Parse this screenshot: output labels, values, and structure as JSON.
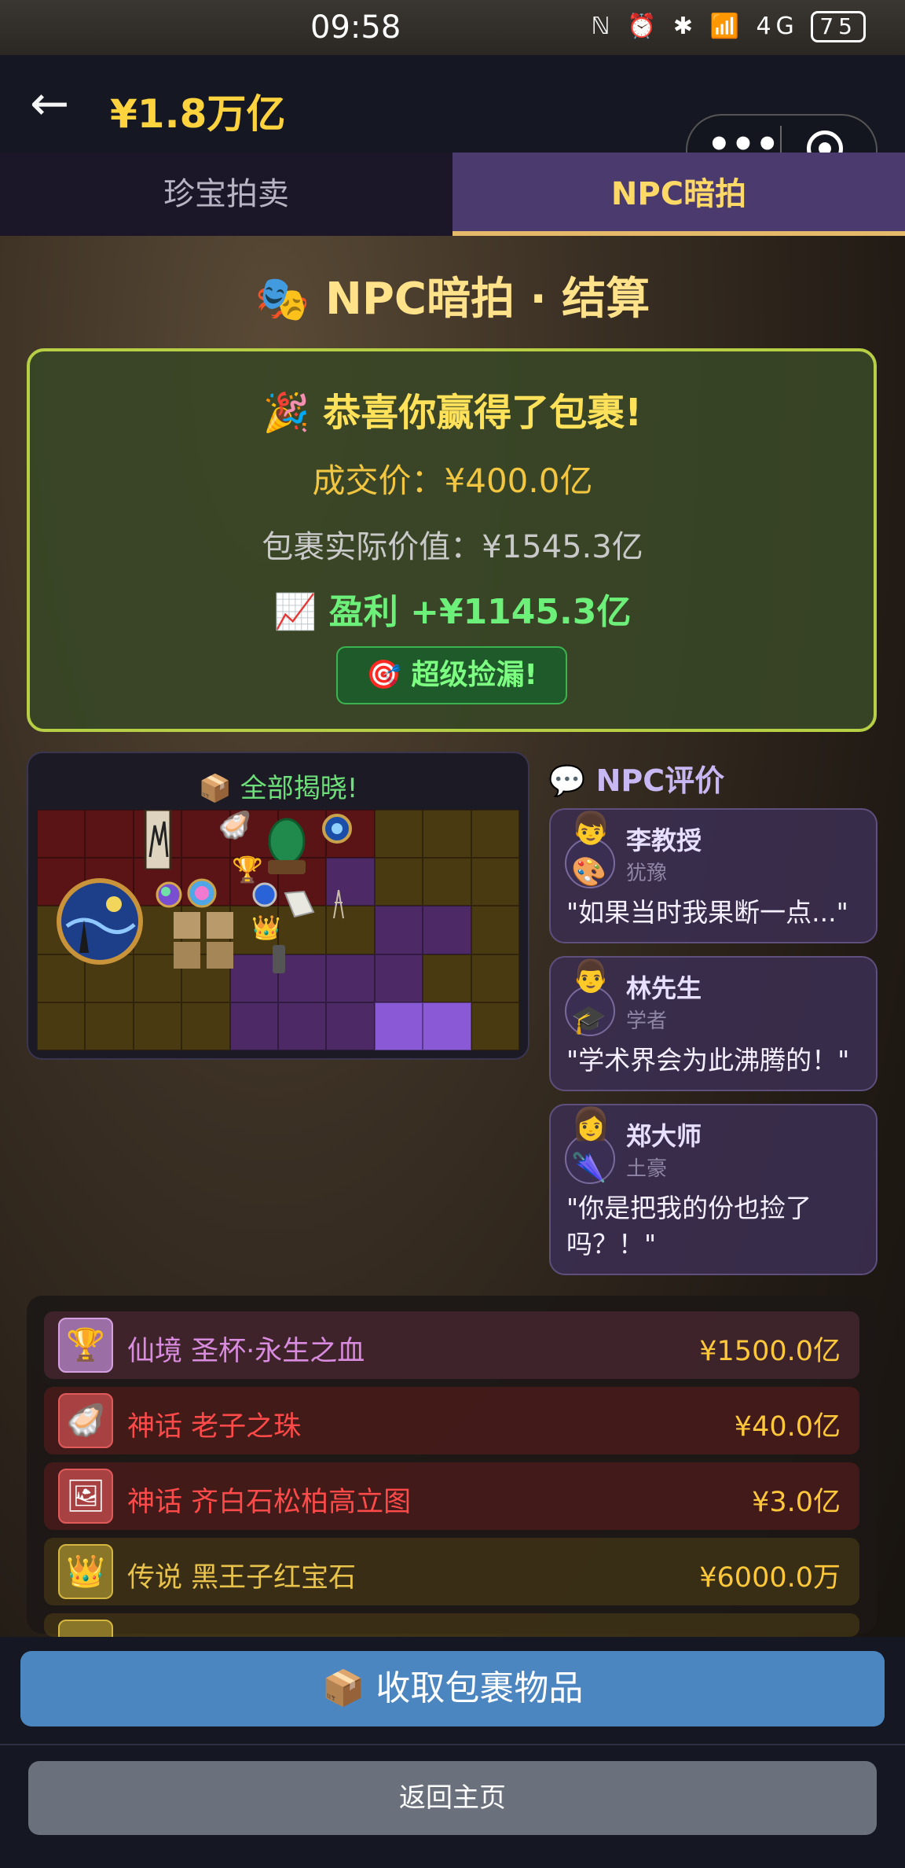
{
  "status_bar": {
    "time": "09:58",
    "icons": "ℕ ⏰ ✱ 📶 4G",
    "battery": "75"
  },
  "header": {
    "back_icon": "←",
    "balance": "¥1.8万亿"
  },
  "capsule": {
    "more": "•••"
  },
  "tabs": [
    {
      "label": "珍宝拍卖",
      "active": false
    },
    {
      "label": "NPC暗拍",
      "active": true
    }
  ],
  "page_title": {
    "icon": "🎭",
    "text": "NPC暗拍 · 结算"
  },
  "result": {
    "icon": "🎉",
    "win_text": "恭喜你赢得了包裹!",
    "deal_price": "成交价：¥400.0亿",
    "actual_value": "包裹实际价值：¥1545.3亿",
    "profit_icon": "📈",
    "profit": "盈利 +¥1145.3亿",
    "badge_icon": "🎯",
    "badge": "超级捡漏!"
  },
  "reveal": {
    "icon": "📦",
    "title": "全部揭晓!"
  },
  "npc_section": {
    "icon": "💬",
    "title": "NPC评价"
  },
  "npcs": [
    {
      "avatar_top": "👦",
      "avatar_bottom": "🎨",
      "name": "李教授",
      "role": "犹豫",
      "quote": "\"如果当时我果断一点...\""
    },
    {
      "avatar_top": "👨",
      "avatar_bottom": "🎓",
      "name": "林先生",
      "role": "学者",
      "quote": "\"学术界会为此沸腾的！\""
    },
    {
      "avatar_top": "👩",
      "avatar_bottom": "🌂",
      "name": "郑大师",
      "role": "土豪",
      "quote": "\"你是把我的份也捡了吗？！\""
    }
  ],
  "items": [
    {
      "icon": "🏆",
      "name": "仙境 圣杯·永生之血",
      "price": "¥1500.0亿",
      "tier": "fairy"
    },
    {
      "icon": "🦪",
      "name": "神话 老子之珠",
      "price": "¥40.0亿",
      "tier": "myth"
    },
    {
      "icon": "🖼",
      "name": "神话 齐白石松柏高立图",
      "price": "¥3.0亿",
      "tier": "myth"
    },
    {
      "icon": "👑",
      "name": "传说 黑王子红宝石",
      "price": "¥6000.0万",
      "tier": "legend"
    }
  ],
  "colors": {
    "fairy": "#d98be0",
    "myth": "#ff4a4a",
    "legend": "#e8c24a",
    "accent": "#ffd33d"
  },
  "actions": {
    "collect_icon": "📦",
    "collect": "收取包裹物品",
    "home": "返回主页"
  }
}
